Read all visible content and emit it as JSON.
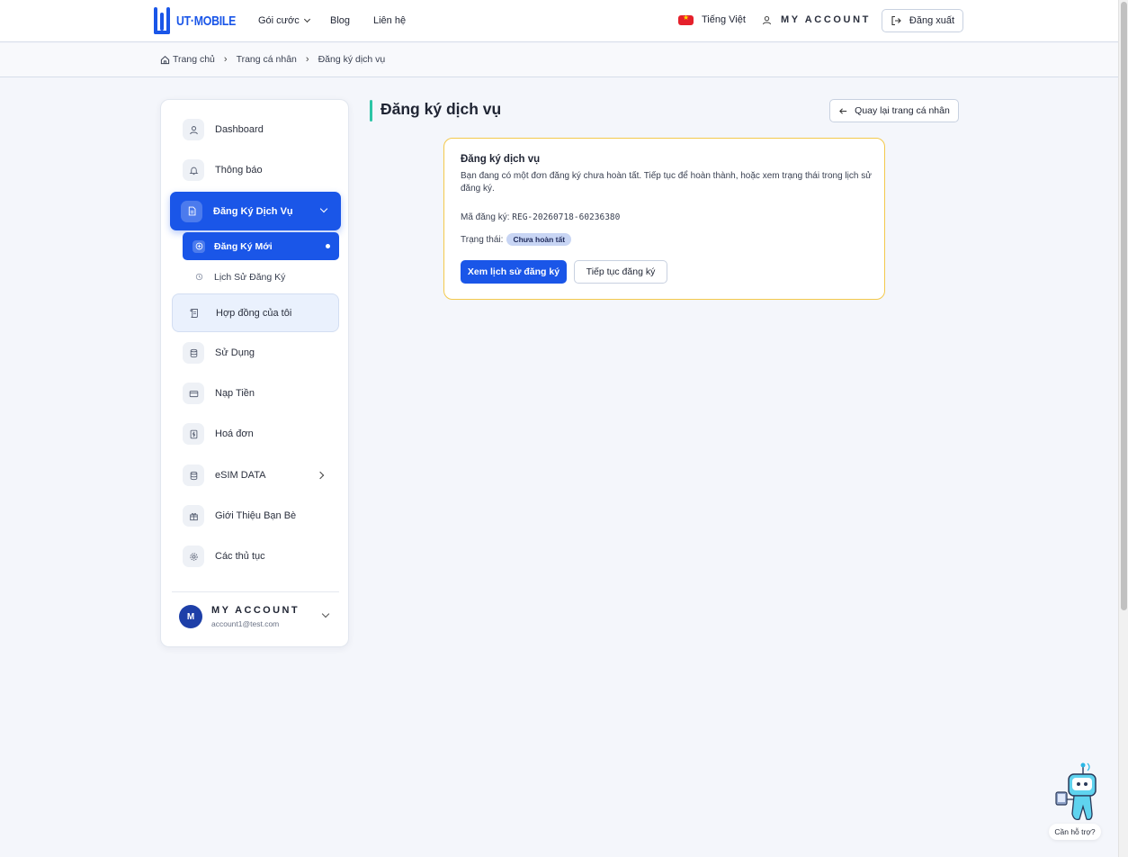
{
  "header": {
    "logo_text": "UT·MOBILE",
    "nav": {
      "plans": "Gói cước",
      "blog": "Blog",
      "contact": "Liên hệ"
    },
    "language": "Tiếng Việt",
    "account": "MY ACCOUNT",
    "logout": "Đăng xuất"
  },
  "breadcrumb": {
    "home": "Trang chủ",
    "profile": "Trang cá nhân",
    "current": "Đăng ký dịch vụ"
  },
  "sidebar": {
    "items": [
      {
        "label": "Dashboard",
        "icon": "user-icon"
      },
      {
        "label": "Thông báo",
        "icon": "bell-icon"
      },
      {
        "label": "Đăng Ký Dịch Vụ",
        "icon": "document-icon"
      },
      {
        "label": "Hợp đồng của tôi",
        "icon": "scroll-icon"
      },
      {
        "label": "Sử Dụng",
        "icon": "database-icon"
      },
      {
        "label": "Nạp Tiền",
        "icon": "card-icon"
      },
      {
        "label": "Hoá đơn",
        "icon": "receipt-icon"
      },
      {
        "label": "eSIM DATA",
        "icon": "database-icon"
      },
      {
        "label": "Giới Thiệu Bạn Bè",
        "icon": "gift-icon"
      },
      {
        "label": "Các thủ tục",
        "icon": "gear-icon"
      }
    ],
    "sub_items": [
      {
        "label": "Đăng Ký Mới",
        "icon": "plus-circle-icon"
      },
      {
        "label": "Lịch Sử Đăng Ký",
        "icon": "history-icon"
      }
    ],
    "user": {
      "initial": "M",
      "name": "MY ACCOUNT",
      "email": "account1@test.com"
    }
  },
  "main": {
    "title": "Đăng ký dịch vụ",
    "back_button": "Quay lại trang cá nhân",
    "card": {
      "title": "Đăng ký dịch vụ",
      "description": "Bạn đang có một đơn đăng ký chưa hoàn tất. Tiếp tục để hoàn thành, hoặc xem trạng thái trong lịch sử đăng ký.",
      "reg_label": "Mã đăng ký:",
      "reg_code": "REG-20260718-60236380",
      "status_label": "Trạng thái:",
      "status_value": "Chưa hoàn tất",
      "primary_button": "Xem lịch sử đăng ký",
      "secondary_button": "Tiếp tục đăng ký"
    }
  },
  "support": {
    "label": "Cần hỗ trợ?"
  },
  "colors": {
    "primary": "#1a56e8",
    "accent": "#2cc5a6",
    "card_border": "#f3c94c",
    "badge_bg": "#c8d5f4"
  }
}
